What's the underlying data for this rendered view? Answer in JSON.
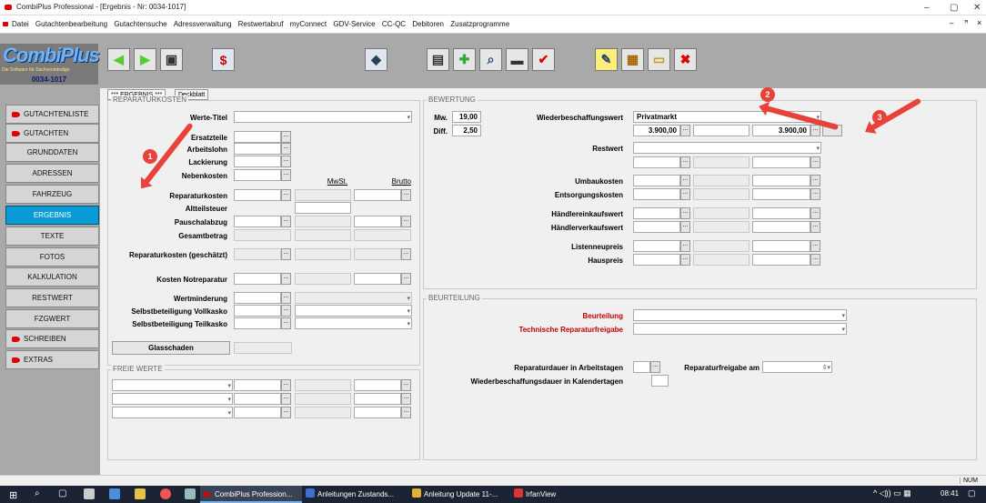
{
  "window": {
    "title": "CombiPlus Professional - [Ergebnis - Nr: 0034-1017]",
    "min": "–",
    "max": "▢",
    "close": "✕",
    "sub_min": "–",
    "sub_restore": "ꟸ",
    "sub_close": "×"
  },
  "menu": [
    "Datei",
    "Gutachtenbearbeitung",
    "Gutachtensuche",
    "Adressverwaltung",
    "Restwertabruf",
    "myConnect",
    "GDV-Service",
    "CC-QC",
    "Debitoren",
    "Zusatzprogramme"
  ],
  "logo": {
    "name": "CombiPlus",
    "subtitle": "Die Software für Sachverständige",
    "number": "0034-1017"
  },
  "sidebar": [
    "GUTACHTENLISTE",
    "GUTACHTEN",
    "GRUNDDATEN",
    "ADRESSEN",
    "FAHRZEUG",
    "ERGEBNIS",
    "TEXTE",
    "FOTOS",
    "KALKULATION",
    "RESTWERT",
    "FZGWERT",
    "SCHREIBEN",
    "EXTRAS"
  ],
  "tabs": {
    "active": "*** ERGEBNIS ***",
    "second": "Deckblatt"
  },
  "reparatur": {
    "title": "REPARATURKOSTEN",
    "werte_titel": "Werte-Titel",
    "ersatzteile": "Ersatzteile",
    "arbeitslohn": "Arbeitslohn",
    "lackierung": "Lackierung",
    "nebenkosten": "Nebenkosten",
    "mwst": "MwSt.",
    "brutto": "Brutto",
    "reparaturkosten": "Reparaturkosten",
    "altteilsteuer": "Altteilsteuer",
    "pauschalabzug": "Pauschalabzug",
    "gesamtbetrag": "Gesamtbetrag",
    "geschaetzt": "Reparaturkosten (geschätzt)",
    "notreparatur": "Kosten Notreparatur",
    "wertminderung": "Wertminderung",
    "sb_voll": "Selbstbeteiligung Vollkasko",
    "sb_teil": "Selbstbeteiligung Teilkasko",
    "glasschaden": "Glasschaden"
  },
  "freie": {
    "title": "FREIE WERTE"
  },
  "bewertung": {
    "title": "BEWERTUNG",
    "mw_label": "Mw.",
    "mw_value": "19,00",
    "diff_label": "Diff.",
    "diff_value": "2,50",
    "wbw": "Wiederbeschaffungswert",
    "wbw_select": "Privatmarkt",
    "wbw_value1": "3.900,00",
    "wbw_value2": "3.900,00",
    "restwert": "Restwert",
    "umbaukosten": "Umbaukosten",
    "entsorgungskosten": "Entsorgungskosten",
    "haendlerein": "Händlereinkaufswert",
    "haendlerver": "Händlerverkaufswert",
    "listenneupreis": "Listenneupreis",
    "hauspreis": "Hauspreis"
  },
  "beurteilung": {
    "title": "BEURTEILUNG",
    "beurteilung": "Beurteilung",
    "tech": "Technische Reparaturfreigabe",
    "dauer": "Reparaturdauer in Arbeitstagen",
    "freigabe": "Reparaturfreigabe am",
    "wbdauer": "Wiederbeschaffungsdauer in Kalendertagen"
  },
  "badges": [
    "1",
    "2",
    "3"
  ],
  "status": {
    "num": "NUM"
  },
  "taskbar": {
    "apps": [
      "CombiPlus Profession...",
      "Anleitungen Zustands...",
      "Anleitung Update 11-...",
      "IrfanView"
    ],
    "time": "08:41"
  },
  "colors": {
    "active_nav": "#0a9ad6",
    "toolbar": "#a9a9a9",
    "annotation": "#e8423a",
    "required_label": "#c00000"
  }
}
